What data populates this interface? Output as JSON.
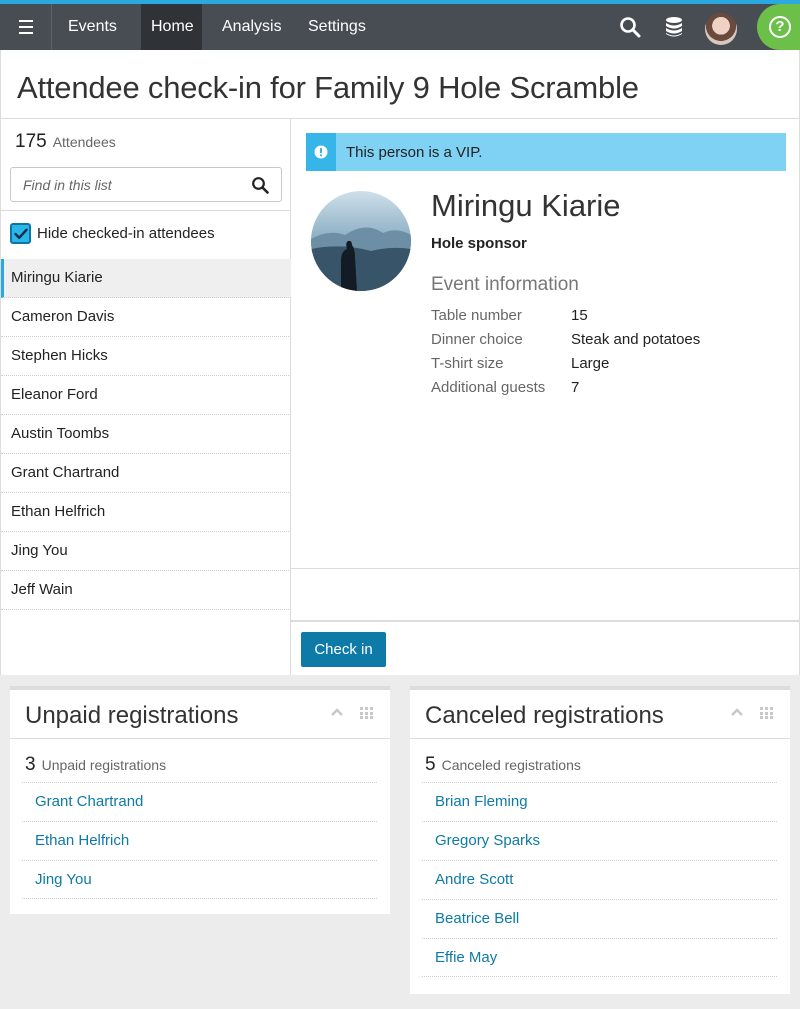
{
  "nav": {
    "events": "Events",
    "home": "Home",
    "analysis": "Analysis",
    "settings": "Settings",
    "accent_color": "#2aa8e0",
    "help_color": "#6cc04a"
  },
  "page": {
    "title": "Attendee check-in for Family 9 Hole Scramble"
  },
  "attendees": {
    "count": "175",
    "count_label": "Attendees",
    "search_placeholder": "Find in this list",
    "hide_label": "Hide checked-in attendees",
    "hide_checked": true,
    "items": [
      "Miringu Kiarie",
      "Cameron Davis",
      "Stephen Hicks",
      "Eleanor Ford",
      "Austin Toombs",
      "Grant Chartrand",
      "Ethan Helfrich",
      "Jing You",
      "Jeff Wain"
    ]
  },
  "detail": {
    "vip_text": "This person is a VIP.",
    "name": "Miringu Kiarie",
    "role": "Hole sponsor",
    "event_heading": "Event information",
    "rows": [
      {
        "key": "Table number",
        "value": "15"
      },
      {
        "key": "Dinner choice",
        "value": "Steak and potatoes"
      },
      {
        "key": "T-shirt size",
        "value": "Large"
      },
      {
        "key": "Additional guests",
        "value": "7"
      }
    ],
    "check_in_label": "Check in"
  },
  "unpaid": {
    "title": "Unpaid registrations",
    "count": "3",
    "count_label": "Unpaid registrations",
    "items": [
      "Grant Chartrand",
      "Ethan Helfrich",
      "Jing You"
    ]
  },
  "canceled": {
    "title": "Canceled registrations",
    "count": "5",
    "count_label": "Canceled registrations",
    "items": [
      "Brian Fleming",
      "Gregory Sparks",
      "Andre Scott",
      "Beatrice Bell",
      "Effie May"
    ]
  }
}
